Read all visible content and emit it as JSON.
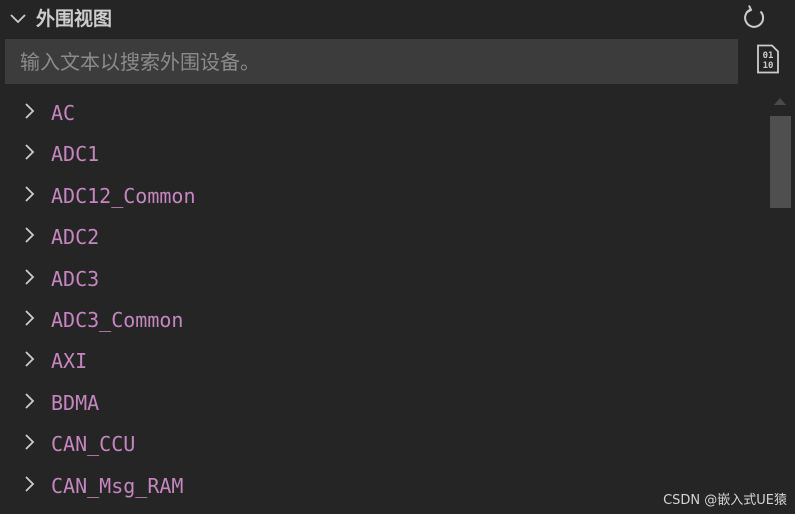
{
  "header": {
    "title": "外围视图",
    "collapse_icon": "chevron-down-icon",
    "refresh_icon": "refresh-icon",
    "binary_icon": "binary-file-icon"
  },
  "search": {
    "placeholder": "输入文本以搜索外围设备。",
    "value": ""
  },
  "tree": {
    "items": [
      {
        "label": "AC"
      },
      {
        "label": "ADC1"
      },
      {
        "label": "ADC12_Common"
      },
      {
        "label": "ADC2"
      },
      {
        "label": "ADC3"
      },
      {
        "label": "ADC3_Common"
      },
      {
        "label": "AXI"
      },
      {
        "label": "BDMA"
      },
      {
        "label": "CAN_CCU"
      },
      {
        "label": "CAN_Msg_RAM"
      }
    ]
  },
  "watermark": "CSDN @嵌入式UE猿",
  "colors": {
    "background": "#252526",
    "item_text": "#c586c0",
    "search_bg": "#3c3c3c"
  }
}
